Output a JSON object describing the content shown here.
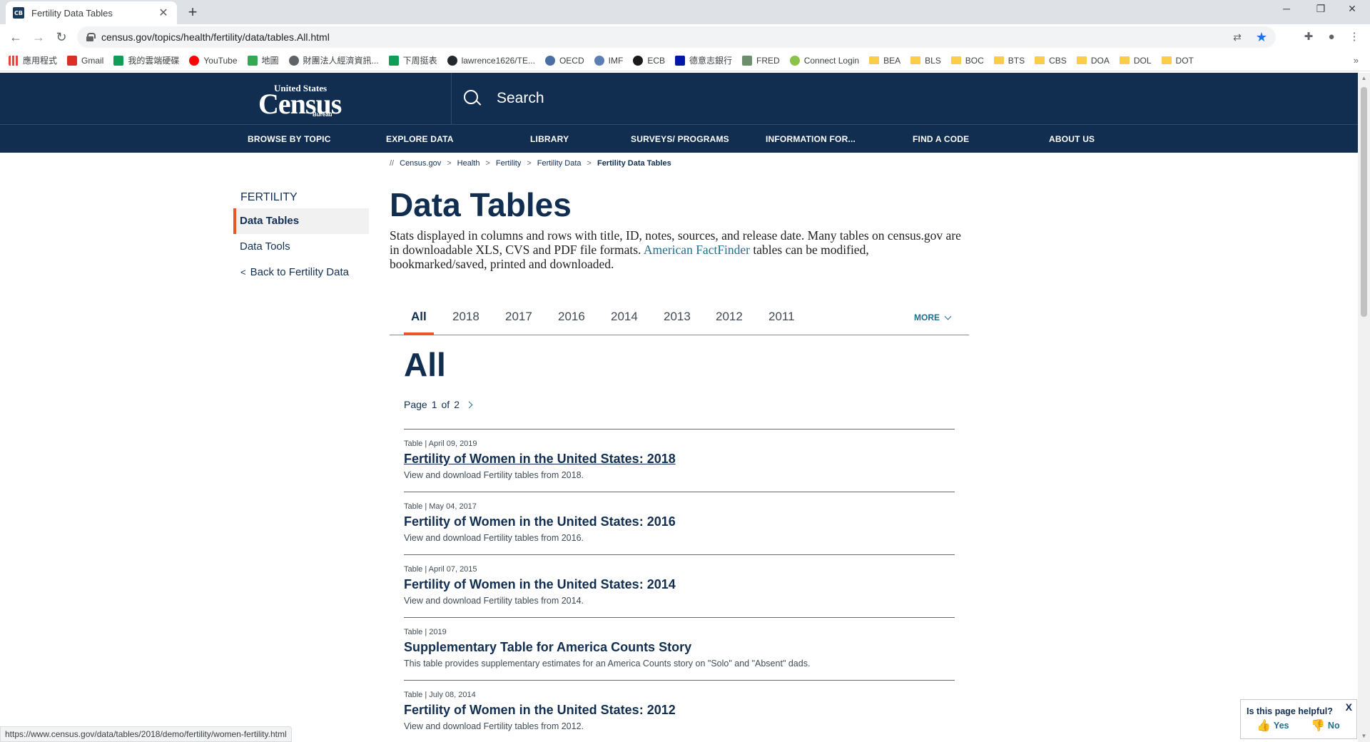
{
  "browser": {
    "tab_title": "Fertility Data Tables",
    "tab_favicon_text": "CB",
    "url": "census.gov/topics/health/fertility/data/tables.All.html",
    "status_url": "https://www.census.gov/data/tables/2018/demo/fertility/women-fertility.html",
    "bookmarks": [
      {
        "label": "應用程式",
        "icon": "apps-icon",
        "color": "#e8453c"
      },
      {
        "label": "Gmail",
        "icon": "gmail-icon",
        "color": "#d93025"
      },
      {
        "label": "我的雲端硬碟",
        "icon": "drive-icon",
        "color": "#0f9d58"
      },
      {
        "label": "YouTube",
        "icon": "youtube-icon",
        "color": "#ff0000"
      },
      {
        "label": "地圖",
        "icon": "maps-icon",
        "color": "#34a853"
      },
      {
        "label": "財團法人經濟資訊...",
        "icon": "globe-icon",
        "color": "#5f6368"
      },
      {
        "label": "下周挺表",
        "icon": "sheets-icon",
        "color": "#0f9d58"
      },
      {
        "label": "lawrence1626/TE...",
        "icon": "github-icon",
        "color": "#24292e"
      },
      {
        "label": "OECD",
        "icon": "oecd-icon",
        "color": "#4a6fa5"
      },
      {
        "label": "IMF",
        "icon": "imf-icon",
        "color": "#5b7fb5"
      },
      {
        "label": "ECB",
        "icon": "ecb-icon",
        "color": "#1b1b1b"
      },
      {
        "label": "德意志銀行",
        "icon": "db-icon",
        "color": "#0018a8"
      },
      {
        "label": "FRED",
        "icon": "fred-icon",
        "color": "#6a8f6a"
      },
      {
        "label": "Connect Login",
        "icon": "connect-icon",
        "color": "#8bc34a"
      },
      {
        "label": "BEA",
        "icon": "folder-icon"
      },
      {
        "label": "BLS",
        "icon": "folder-icon"
      },
      {
        "label": "BOC",
        "icon": "folder-icon"
      },
      {
        "label": "BTS",
        "icon": "folder-icon"
      },
      {
        "label": "CBS",
        "icon": "folder-icon"
      },
      {
        "label": "DOA",
        "icon": "folder-icon"
      },
      {
        "label": "DOL",
        "icon": "folder-icon"
      },
      {
        "label": "DOT",
        "icon": "folder-icon"
      }
    ],
    "bookmarks_more": "»"
  },
  "header": {
    "logo_top": "United States",
    "logo_main": "Census",
    "logo_bottom": "Bureau",
    "search_label": "Search",
    "brand_color": "#112e51",
    "accent_color": "#e8562a"
  },
  "nav": [
    "BROWSE BY TOPIC",
    "EXPLORE DATA",
    "LIBRARY",
    "SURVEYS/ PROGRAMS",
    "INFORMATION FOR...",
    "FIND A CODE",
    "ABOUT US"
  ],
  "breadcrumb": {
    "prefix": "//",
    "items": [
      "Census.gov",
      "Health",
      "Fertility",
      "Fertility Data"
    ],
    "current": "Fertility Data Tables",
    "separator": ">"
  },
  "sidenav": {
    "heading": "FERTILITY",
    "items": [
      "Data Tables",
      "Data Tools"
    ],
    "back": "Back to Fertility Data"
  },
  "main": {
    "title": "Data Tables",
    "intro_text": "Stats displayed in columns and rows with title, ID, notes, sources, and release date. Many tables on census.gov are in downloadable XLS, CVS and PDF file formats.",
    "intro_link": "American FactFinder",
    "intro_tail": "tables can be modified, bookmarked/saved, printed and downloaded.",
    "tabs": [
      "All",
      "2018",
      "2017",
      "2016",
      "2014",
      "2013",
      "2012",
      "2011"
    ],
    "more_label": "MORE",
    "section_title": "All",
    "pager": {
      "label": "Page",
      "current": "1",
      "of": "of",
      "total": "2"
    },
    "results": [
      {
        "meta": "Table | April 09, 2019",
        "title": "Fertility of Women in the United States: 2018",
        "desc": "View and download Fertility tables from 2018."
      },
      {
        "meta": "Table | May 04, 2017",
        "title": "Fertility of Women in the United States: 2016",
        "desc": "View and download Fertility tables from 2016."
      },
      {
        "meta": "Table | April 07, 2015",
        "title": "Fertility of Women in the United States: 2014",
        "desc": "View and download Fertility tables from 2014."
      },
      {
        "meta": "Table | 2019",
        "title": "Supplementary Table for America Counts Story",
        "desc": "This table provides supplementary estimates for an America Counts story on \"Solo\" and \"Absent\" dads."
      },
      {
        "meta": "Table | July 08, 2014",
        "title": "Fertility of Women in the United States: 2012",
        "desc": "View and download Fertility tables from 2012."
      }
    ]
  },
  "feedback": {
    "question": "Is this page helpful?",
    "yes": "Yes",
    "no": "No",
    "close": "X"
  }
}
